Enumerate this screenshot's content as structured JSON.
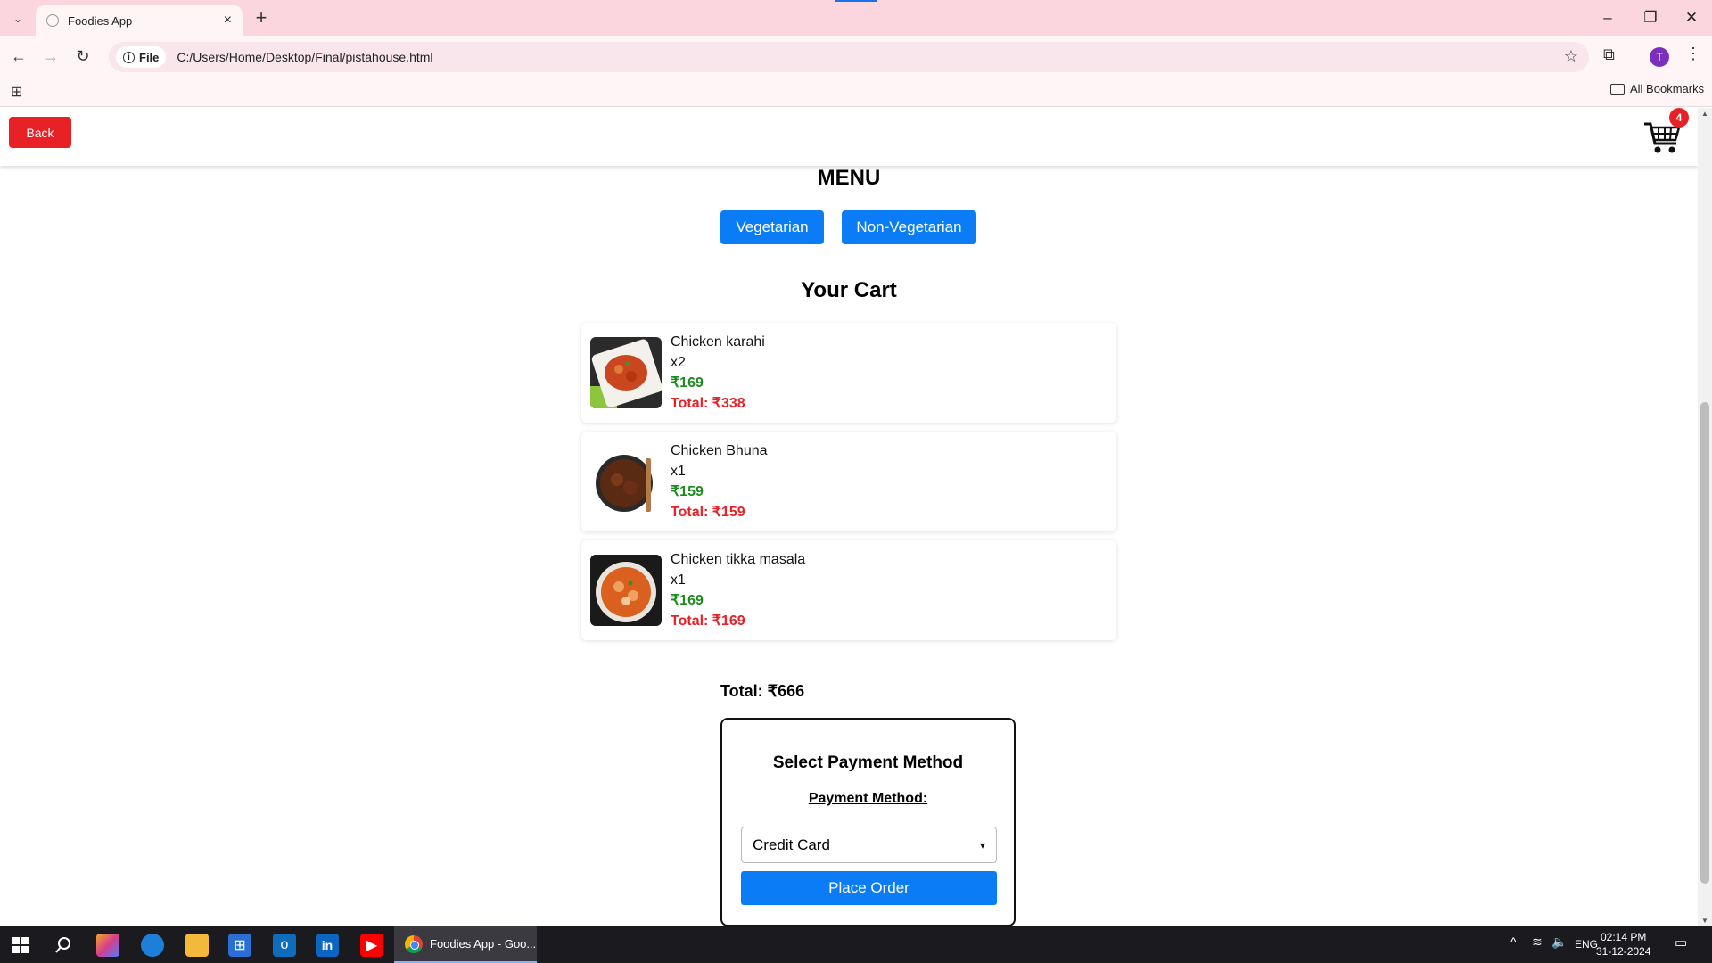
{
  "browser": {
    "tab_title": "Foodies App",
    "url_chip": "File",
    "url": "C:/Users/Home/Desktop/Final/pistahouse.html",
    "profile_initial": "T",
    "all_bookmarks": "All Bookmarks"
  },
  "header": {
    "back_label": "Back",
    "cart_count": "4"
  },
  "menu": {
    "title": "MENU",
    "categories": [
      "Vegetarian",
      "Non-Vegetarian"
    ]
  },
  "cart": {
    "title": "Your Cart",
    "items": [
      {
        "name": "Chicken karahi",
        "qty": "x2",
        "price": "₹169",
        "total": "Total: ₹338"
      },
      {
        "name": "Chicken Bhuna",
        "qty": "x1",
        "price": "₹159",
        "total": "Total: ₹159"
      },
      {
        "name": "Chicken tikka masala",
        "qty": "x1",
        "price": "₹169",
        "total": "Total: ₹169"
      }
    ],
    "grand_total": "Total: ₹666"
  },
  "payment": {
    "title": "Select Payment Method",
    "label": "Payment Method:",
    "selected": "Credit Card",
    "place_order": "Place Order"
  },
  "taskbar": {
    "active_app": "Foodies App - Goo...",
    "language": "ENG",
    "time": "02:14 PM",
    "date": "31-12-2024"
  },
  "colors": {
    "accent_blue": "#0a7cf5",
    "danger_red": "#e82127",
    "price_green": "#1f8a1f",
    "chrome_pink": "#fbd6df"
  }
}
